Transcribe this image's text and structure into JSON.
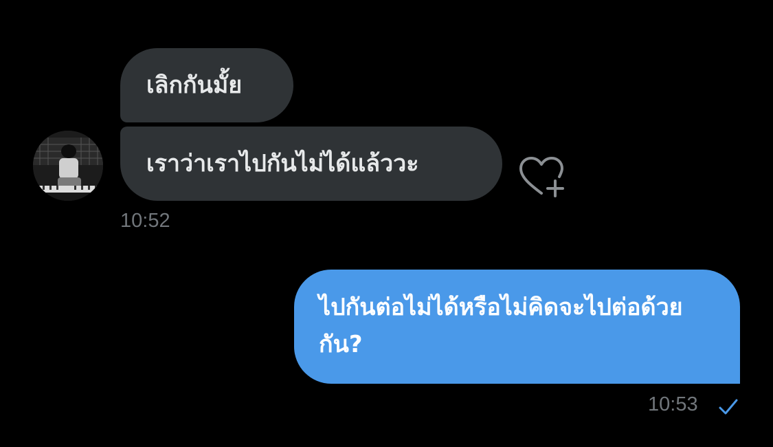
{
  "conversation": {
    "messages": [
      {
        "sender": "other",
        "text": "เลิกกันมั้ย"
      },
      {
        "sender": "other",
        "text": "เราว่าเราไปกันไม่ได้แล้ววะ"
      },
      {
        "sender": "me",
        "text": "ไปกันต่อไม่ได้หรือไม่คิดจะไปต่อด้วยกัน?"
      }
    ],
    "incoming_time": "10:52",
    "outgoing_time": "10:53"
  },
  "icons": {
    "avatar": "contact-avatar",
    "reaction": "heart-plus-icon",
    "read_status": "checkmark-icon"
  },
  "colors": {
    "background": "#000000",
    "incoming_bubble": "#2f3336",
    "outgoing_bubble": "#4a99e9",
    "timestamp": "#71767b",
    "checkmark": "#4a99e9"
  }
}
